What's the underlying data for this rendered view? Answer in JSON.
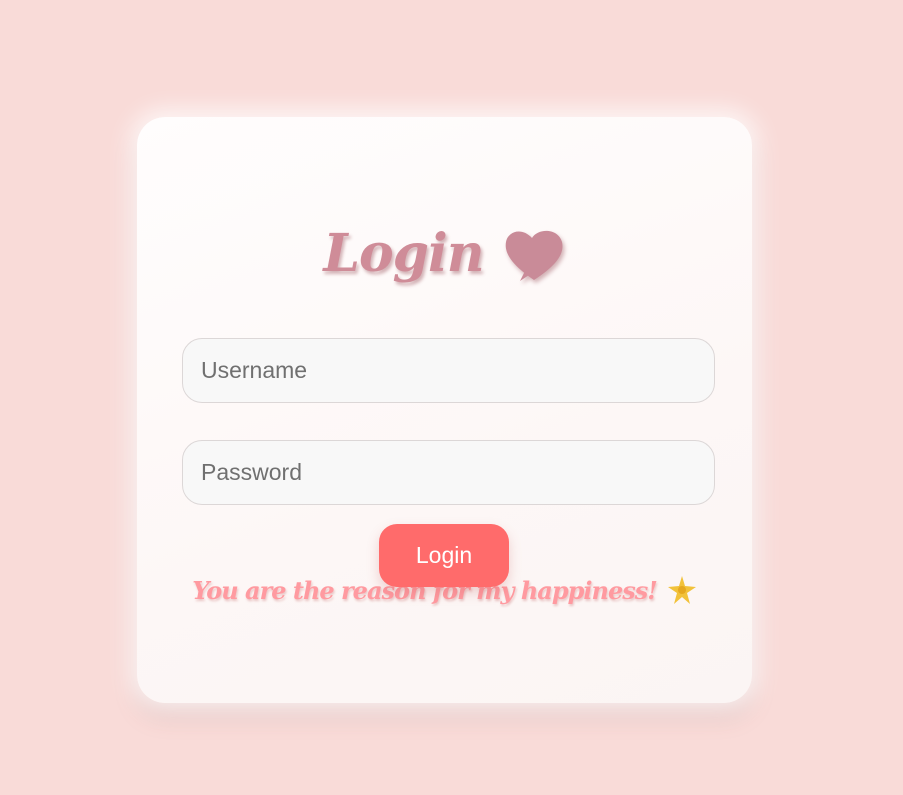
{
  "login_card": {
    "title": "Login",
    "title_icon": "heart-icon",
    "username": {
      "placeholder": "Username",
      "value": ""
    },
    "password": {
      "placeholder": "Password",
      "value": ""
    },
    "login_button_label": "Login",
    "message": "You are the reason for my happiness!",
    "message_icon": "sparkle-icon"
  },
  "colors": {
    "background": "#f9dbd8",
    "card": "#fffdfd",
    "title": "#cf8c98",
    "button": "#ff6b6b",
    "message": "#ff9aa0"
  }
}
